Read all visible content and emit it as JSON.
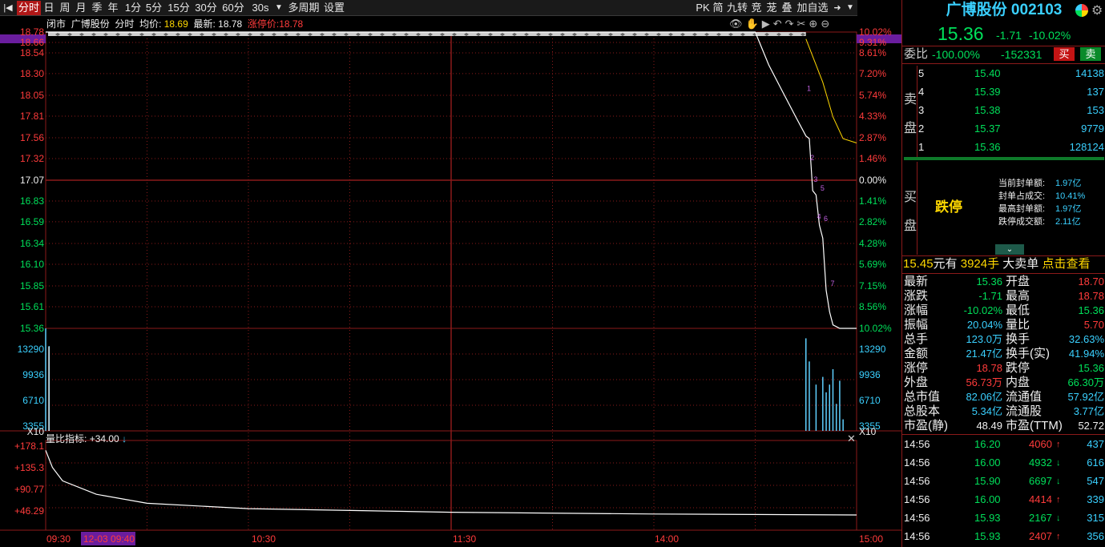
{
  "toolbar": {
    "items": [
      "分时",
      "日",
      "周",
      "月",
      "季",
      "年",
      "1分",
      "5分",
      "15分",
      "30分",
      "60分",
      "30s",
      "多周期",
      "设置"
    ],
    "active": "分时",
    "right_items": [
      "PK",
      "简",
      "九转",
      "竞",
      "茏",
      "叠",
      "加自选"
    ]
  },
  "info_bar": {
    "status": "闭市",
    "name": "广博股份",
    "mode": "分时",
    "avg_label": "均价:",
    "avg_value": "18.69",
    "latest_label": "最新:",
    "latest_value": "18.78",
    "limit_label": "涨停价:",
    "limit_value": "18.78"
  },
  "price_axis_left": [
    "18.78",
    "18.66",
    "18.54",
    "18.30",
    "18.05",
    "17.81",
    "17.56",
    "17.32",
    "17.07",
    "16.83",
    "16.59",
    "16.34",
    "16.10",
    "15.85",
    "15.61",
    "15.36"
  ],
  "pct_axis_right": [
    "10.02%",
    "9.31%",
    "8.61%",
    "7.20%",
    "5.74%",
    "4.33%",
    "2.87%",
    "1.46%",
    "0.00%",
    "1.41%",
    "2.82%",
    "4.28%",
    "5.69%",
    "7.15%",
    "8.56%",
    "10.02%"
  ],
  "volume_axis": [
    "13290",
    "9936",
    "6710",
    "3355"
  ],
  "volume_unit": "X10",
  "indicator": {
    "label": "量比指标:",
    "value": "+34.00",
    "arrow": "↓",
    "axis": [
      "+178.1",
      "+135.3",
      "+90.77",
      "+46.29"
    ]
  },
  "time_axis": [
    "09:30",
    "12-03 09:40",
    "10:30",
    "11:30",
    "14:00",
    "15:00"
  ],
  "markers": [
    "1",
    "2",
    "3",
    "4",
    "5",
    "6",
    "7"
  ],
  "chart_data": {
    "type": "line",
    "title": "",
    "y_range": [
      15.36,
      18.78
    ],
    "prev_close": 17.07,
    "x": [
      "09:30",
      "14:30",
      "14:34",
      "14:38",
      "14:42",
      "14:45",
      "14:46",
      "14:47",
      "14:48",
      "14:49",
      "14:50",
      "14:51",
      "14:52",
      "14:53",
      "14:54",
      "14:55",
      "14:56",
      "15:00"
    ],
    "series": [
      {
        "values": [
          18.78,
          18.78,
          18.4,
          18.1,
          17.8,
          17.58,
          17.55,
          16.95,
          16.9,
          16.55,
          16.4,
          15.8,
          15.55,
          15.4,
          15.38,
          15.36,
          15.36,
          15.36
        ]
      }
    ],
    "volume_x": [
      "09:30",
      "09:31",
      "14:45",
      "14:46",
      "14:48",
      "14:50",
      "14:51",
      "14:52",
      "14:53",
      "14:54",
      "14:55",
      "14:56"
    ],
    "volume": [
      13290,
      11000,
      12000,
      9000,
      6000,
      7000,
      5000,
      6000,
      8000,
      3500,
      6500,
      1500
    ],
    "volume_ratio_x": [
      "09:30",
      "09:32",
      "09:35",
      "09:45",
      "10:00",
      "10:30",
      "11:30",
      "14:00",
      "15:00"
    ],
    "volume_ratio": [
      178.1,
      140,
      110,
      80,
      60,
      48,
      40,
      36,
      34
    ]
  },
  "right_panel": {
    "title": "广博股份 002103",
    "price": "15.36",
    "change": "-1.71",
    "change_pct": "-10.02%",
    "weibi_label": "委比",
    "weibi_pct": "-100.00%",
    "weibi_diff": "-152331",
    "buy_btn": "买",
    "sell_btn": "卖",
    "sell_label_1": "卖",
    "sell_label_2": "盘",
    "sell_orders": [
      {
        "level": "5",
        "price": "15.40",
        "vol": "14138"
      },
      {
        "level": "4",
        "price": "15.39",
        "vol": "137"
      },
      {
        "level": "3",
        "price": "15.38",
        "vol": "153"
      },
      {
        "level": "2",
        "price": "15.37",
        "vol": "9779"
      },
      {
        "level": "1",
        "price": "15.36",
        "vol": "128124"
      }
    ],
    "buy_label_1": "买",
    "buy_label_2": "盘",
    "limit_down": "跌停",
    "seal_info": [
      {
        "label": "当前封单额:",
        "value": "1.97亿"
      },
      {
        "label": "封单占成交:",
        "value": "10.41%"
      },
      {
        "label": "最高封单额:",
        "value": "1.97亿"
      },
      {
        "label": "跌停成交额:",
        "value": "2.11亿"
      }
    ],
    "big_order": {
      "price": "15.45",
      "unit1": "元有",
      "qty": "3924手",
      "label": "大卖单",
      "link": "点击查看"
    },
    "stats": [
      {
        "l1": "最新",
        "v1": "15.36",
        "c1": "green",
        "l2": "开盘",
        "v2": "18.70",
        "c2": "red"
      },
      {
        "l1": "涨跌",
        "v1": "-1.71",
        "c1": "green",
        "l2": "最高",
        "v2": "18.78",
        "c2": "red"
      },
      {
        "l1": "涨幅",
        "v1": "-10.02%",
        "c1": "green",
        "l2": "最低",
        "v2": "15.36",
        "c2": "green"
      },
      {
        "l1": "振幅",
        "v1": "20.04%",
        "c1": "cyan",
        "l2": "量比",
        "v2": "5.70",
        "c2": "red"
      },
      {
        "l1": "总手",
        "v1": "123.0万",
        "c1": "cyan",
        "l2": "换手",
        "v2": "32.63%",
        "c2": "cyan"
      },
      {
        "l1": "金额",
        "v1": "21.47亿",
        "c1": "cyan",
        "l2": "换手(实)",
        "v2": "41.94%",
        "c2": "cyan"
      },
      {
        "l1": "涨停",
        "v1": "18.78",
        "c1": "red",
        "l2": "跌停",
        "v2": "15.36",
        "c2": "green"
      },
      {
        "l1": "外盘",
        "v1": "56.73万",
        "c1": "red",
        "l2": "内盘",
        "v2": "66.30万",
        "c2": "green"
      },
      {
        "l1": "总市值",
        "v1": "82.06亿",
        "c1": "cyan",
        "l2": "流通值",
        "v2": "57.92亿",
        "c2": "cyan"
      },
      {
        "l1": "总股本",
        "v1": "5.34亿",
        "c1": "cyan",
        "l2": "流通股",
        "v2": "3.77亿",
        "c2": "cyan"
      },
      {
        "l1": "市盈(静)",
        "v1": "48.49",
        "c1": "white",
        "l2": "市盈(TTM)",
        "v2": "52.72",
        "c2": "white"
      }
    ],
    "ticks": [
      {
        "time": "14:56",
        "price": "16.20",
        "pc": "green",
        "vol": "4060",
        "vc": "red",
        "dir": "up",
        "n": "437"
      },
      {
        "time": "14:56",
        "price": "16.00",
        "pc": "green",
        "vol": "4932",
        "vc": "green",
        "dir": "down",
        "n": "616"
      },
      {
        "time": "14:56",
        "price": "15.90",
        "pc": "green",
        "vol": "6697",
        "vc": "green",
        "dir": "down",
        "n": "547"
      },
      {
        "time": "14:56",
        "price": "16.00",
        "pc": "green",
        "vol": "4414",
        "vc": "red",
        "dir": "up",
        "n": "339"
      },
      {
        "time": "14:56",
        "price": "15.93",
        "pc": "green",
        "vol": "2167",
        "vc": "green",
        "dir": "down",
        "n": "315"
      },
      {
        "time": "14:56",
        "price": "15.93",
        "pc": "green",
        "vol": "2407",
        "vc": "red",
        "dir": "up",
        "n": "356"
      }
    ]
  },
  "colors": {
    "up": "#ff3b3b",
    "down": "#00e05a",
    "grid": "#8b1a1a",
    "accent": "#3ad0ff",
    "highlight": "#ffd800"
  }
}
